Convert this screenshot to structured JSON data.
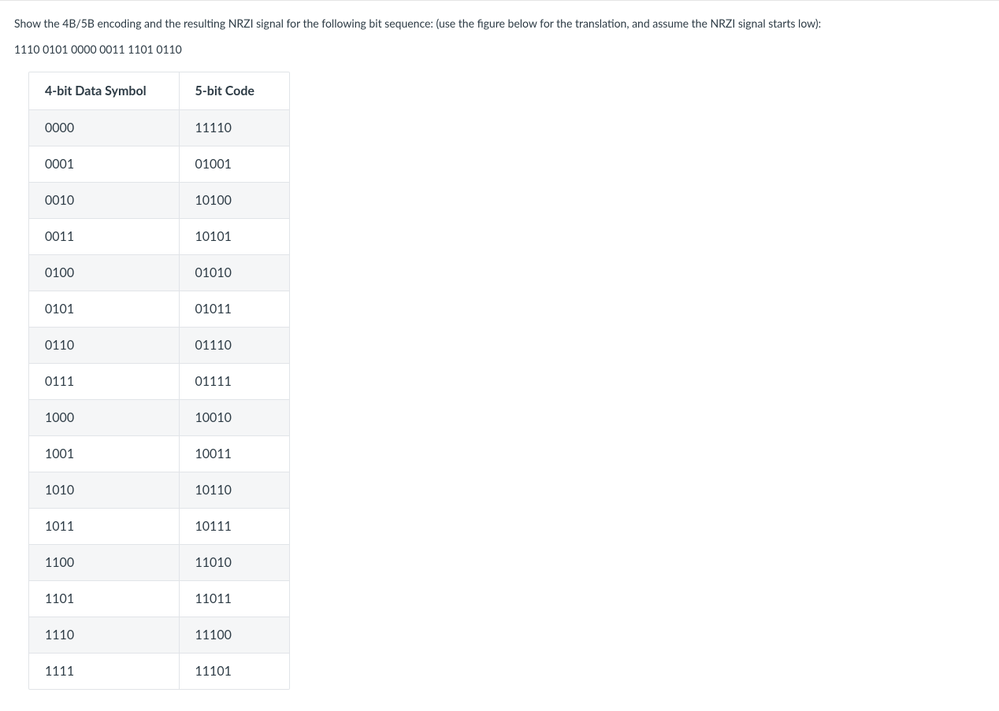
{
  "question": {
    "prompt": "Show the 4B/5B encoding and the resulting NRZI signal for the following bit sequence:  (use the figure below for the translation, and assume the NRZI signal starts low):",
    "bit_sequence": "1110 0101 0000 0011 1101 0110"
  },
  "table": {
    "headers": {
      "symbol": "4-bit Data Symbol",
      "code": "5-bit Code"
    },
    "rows": [
      {
        "symbol": "0000",
        "code": "11110"
      },
      {
        "symbol": "0001",
        "code": "01001"
      },
      {
        "symbol": "0010",
        "code": "10100"
      },
      {
        "symbol": "0011",
        "code": "10101"
      },
      {
        "symbol": "0100",
        "code": "01010"
      },
      {
        "symbol": "0101",
        "code": "01011"
      },
      {
        "symbol": "0110",
        "code": "01110"
      },
      {
        "symbol": "0111",
        "code": "01111"
      },
      {
        "symbol": "1000",
        "code": "10010"
      },
      {
        "symbol": "1001",
        "code": "10011"
      },
      {
        "symbol": "1010",
        "code": "10110"
      },
      {
        "symbol": "1011",
        "code": "10111"
      },
      {
        "symbol": "1100",
        "code": "11010"
      },
      {
        "symbol": "1101",
        "code": "11011"
      },
      {
        "symbol": "1110",
        "code": "11100"
      },
      {
        "symbol": "1111",
        "code": "11101"
      }
    ]
  }
}
